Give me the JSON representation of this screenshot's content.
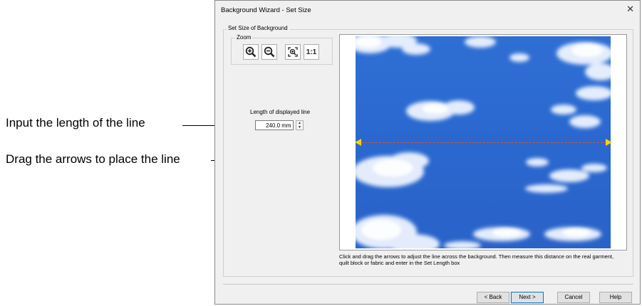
{
  "callouts": {
    "input_length": "Input the length of the line",
    "drag_arrows": "Drag the arrows to place the line"
  },
  "dialog": {
    "title": "Background Wizard - Set Size",
    "close_glyph": "✕",
    "group_label": "Set Size of Background",
    "zoom": {
      "label": "Zoom",
      "buttons": [
        {
          "icon": "zoom-in-icon"
        },
        {
          "icon": "zoom-out-icon"
        },
        {
          "icon": "zoom-fit-icon"
        },
        {
          "icon": "zoom-actual-icon",
          "text": "1:1"
        }
      ]
    },
    "length": {
      "label": "Length of displayed line",
      "value": "240.0 mm"
    },
    "hint": "Click and drag the arrows to adjust the line across the background. Then measure this distance on the real garment, quilt block or fabric and enter in the Set Length box",
    "buttons": {
      "back": "< Back",
      "next": "Next >",
      "cancel": "Cancel",
      "help": "Help"
    }
  },
  "colors": {
    "sky": "#2a68cf",
    "marker": "#f2d600",
    "measure_line": "#e0541f"
  }
}
